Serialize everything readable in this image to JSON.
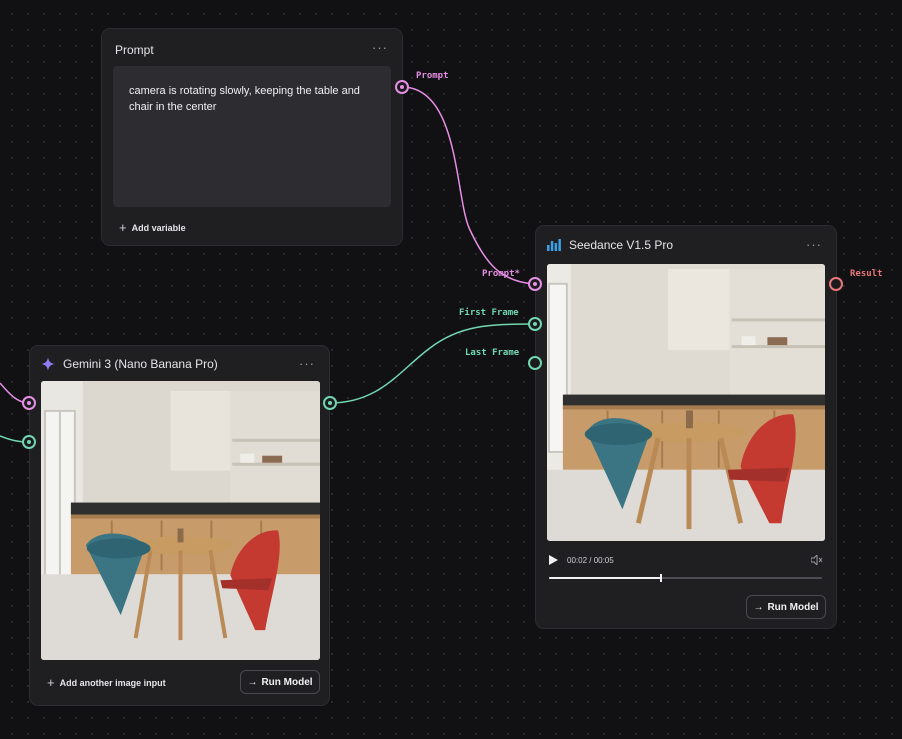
{
  "prompt_node": {
    "title": "Prompt",
    "menu_label": "···",
    "text": "camera is rotating slowly, keeping the table and chair in the center",
    "add_variable_label": "Add variable",
    "output_port_label": "Prompt"
  },
  "gemini_node": {
    "title": "Gemini 3 (Nano Banana Pro)",
    "menu_label": "···",
    "add_image_label": "Add another image input",
    "run_label": "Run Model",
    "icon": "sparkle-icon"
  },
  "seedance_node": {
    "title": "Seedance V1.5 Pro",
    "menu_label": "···",
    "input_ports": {
      "prompt": "Prompt*",
      "first_frame": "First Frame",
      "last_frame": "Last Frame"
    },
    "output_port": "Result",
    "player": {
      "time": "00:02 / 00:05",
      "progress": 0.41
    },
    "run_label": "Run Model",
    "icon": "bar-chart-icon"
  },
  "colors": {
    "pink": "#e58ee5",
    "green": "#72d7b0",
    "red": "#e87878",
    "background": "#111113",
    "node": "#1f1f22"
  }
}
